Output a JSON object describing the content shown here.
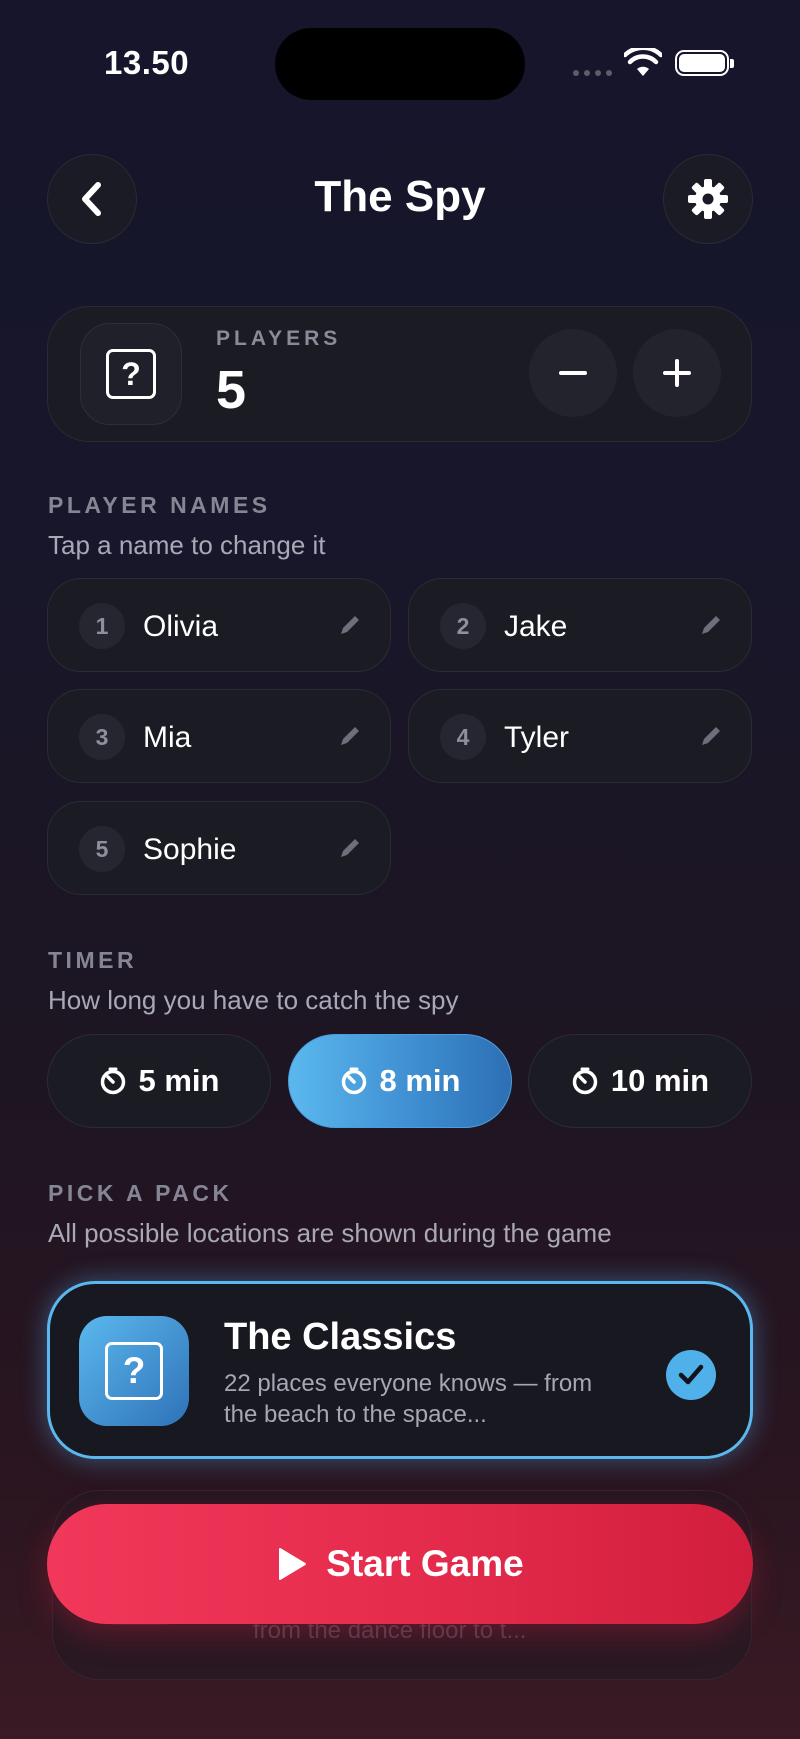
{
  "status_bar": {
    "time": "13.50"
  },
  "header": {
    "title": "The Spy",
    "back_icon": "chevron-left-icon",
    "settings_icon": "gear-icon"
  },
  "players": {
    "label": "PLAYERS",
    "count": "5",
    "decrement": "−",
    "increment": "+"
  },
  "player_names": {
    "label": "PLAYER NAMES",
    "hint": "Tap a name to change it",
    "items": [
      {
        "number": "1",
        "name": "Olivia"
      },
      {
        "number": "2",
        "name": "Jake"
      },
      {
        "number": "3",
        "name": "Mia"
      },
      {
        "number": "4",
        "name": "Tyler"
      },
      {
        "number": "5",
        "name": "Sophie"
      }
    ]
  },
  "timer": {
    "label": "TIMER",
    "hint": "How long you have to catch the spy",
    "options": [
      {
        "label": "5 min",
        "selected": false
      },
      {
        "label": "8 min",
        "selected": true
      },
      {
        "label": "10 min",
        "selected": false
      }
    ]
  },
  "pack": {
    "label": "PICK A PACK",
    "hint": "All possible locations are shown during the game",
    "selected": {
      "title": "The Classics",
      "description": "22 places everyone knows — from the beach to the space...",
      "checked": true
    },
    "next_preview": "from the dance floor to t..."
  },
  "start_button": {
    "label": "Start Game"
  },
  "colors": {
    "accent_blue": "#5bb8ee",
    "start_red": "#e42b4c",
    "background": "#17162a"
  }
}
